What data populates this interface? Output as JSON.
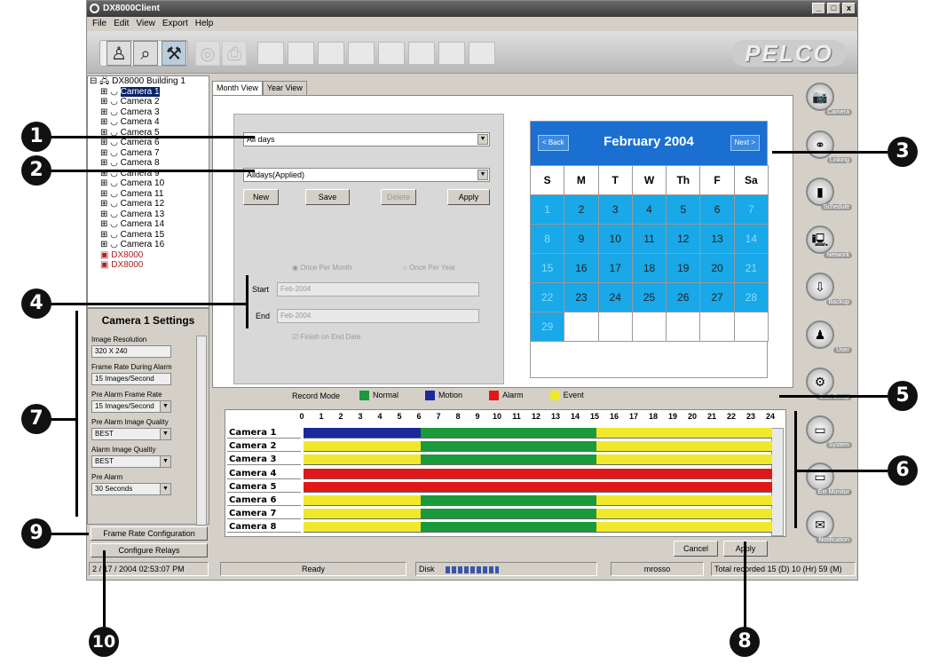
{
  "window": {
    "title": "DX8000Client",
    "controls": [
      "_",
      "□",
      "x"
    ]
  },
  "menu": [
    "File",
    "Edit",
    "View",
    "Export",
    "Help"
  ],
  "brand": "PELCO",
  "tree": {
    "root": "DX8000 Building 1",
    "items": [
      "Camera 1",
      "Camera 2",
      "Camera 3",
      "Camera 4",
      "Camera 5",
      "Camera 6",
      "Camera 7",
      "Camera 8",
      "Camera 9",
      "Camera 10",
      "Camera 11",
      "Camera 12",
      "Camera 13",
      "Camera 14",
      "Camera 15",
      "Camera 16"
    ],
    "second_root": "DX8000",
    "third_root": "DX8000"
  },
  "settings": {
    "title": "Camera 1 Settings",
    "fields": [
      {
        "label": "Image Resolution",
        "value": "320 X 240"
      },
      {
        "label": "Frame Rate During Alarm",
        "value": "15 Images/Second"
      },
      {
        "label": "Pre Alarm Frame Rate",
        "value": "15 Images/Second"
      },
      {
        "label": "Pre Alarm Image Quality",
        "value": "BEST"
      },
      {
        "label": "Alarm Image Quality",
        "value": "BEST"
      },
      {
        "label": "Pre Alarm",
        "value": "30 Seconds"
      }
    ],
    "frame_rate_btn": "Frame Rate Configuration",
    "relays_btn": "Configure Relays"
  },
  "tabs": [
    "Month View",
    "Year View"
  ],
  "schedule": {
    "days_value": "All days",
    "schedule_value": "Alldays(Applied)",
    "new": "New",
    "save": "Save",
    "delete": "Delete",
    "apply": "Apply",
    "radio1": "Once Per Month",
    "radio2": "Once Per Year",
    "start_label": "Start",
    "start_value": "Feb-2004",
    "end_label": "End",
    "end_value": "Feb-2004",
    "finish_label": "Finish on End Date"
  },
  "calendar": {
    "back": "< Back",
    "next": "Next >",
    "title": "February  2004",
    "dow": [
      "S",
      "M",
      "T",
      "W",
      "Th",
      "F",
      "Sa"
    ],
    "days": [
      "1",
      "2",
      "3",
      "4",
      "5",
      "6",
      "7",
      "8",
      "9",
      "10",
      "11",
      "12",
      "13",
      "14",
      "15",
      "16",
      "17",
      "18",
      "19",
      "20",
      "21",
      "22",
      "23",
      "24",
      "25",
      "26",
      "27",
      "28",
      "29"
    ]
  },
  "legend": {
    "title": "Record Mode",
    "items": [
      {
        "label": "Normal",
        "color": "#1a9a3a"
      },
      {
        "label": "Motion",
        "color": "#1a2a9a"
      },
      {
        "label": "Alarm",
        "color": "#e01818"
      },
      {
        "label": "Event",
        "color": "#f0e82a"
      }
    ]
  },
  "timeline": {
    "hours": [
      "0",
      "1",
      "2",
      "3",
      "4",
      "5",
      "6",
      "7",
      "8",
      "9",
      "10",
      "11",
      "12",
      "13",
      "14",
      "15",
      "16",
      "17",
      "18",
      "19",
      "20",
      "21",
      "22",
      "23",
      "24"
    ],
    "rows": [
      {
        "name": "Camera 1",
        "segments": [
          [
            "#1a2a9a",
            0,
            6
          ],
          [
            "#1a9a3a",
            6,
            15
          ],
          [
            "#f0e82a",
            15,
            24
          ]
        ]
      },
      {
        "name": "Camera 2",
        "segments": [
          [
            "#f0e82a",
            0,
            6
          ],
          [
            "#1a9a3a",
            6,
            15
          ],
          [
            "#f0e82a",
            15,
            24
          ]
        ]
      },
      {
        "name": "Camera 3",
        "segments": [
          [
            "#f0e82a",
            0,
            6
          ],
          [
            "#1a9a3a",
            6,
            15
          ],
          [
            "#f0e82a",
            15,
            24
          ]
        ]
      },
      {
        "name": "Camera 4",
        "segments": [
          [
            "#e01818",
            0,
            24
          ]
        ]
      },
      {
        "name": "Camera 5",
        "segments": [
          [
            "#e01818",
            0,
            24
          ]
        ]
      },
      {
        "name": "Camera 6",
        "segments": [
          [
            "#f0e82a",
            0,
            6
          ],
          [
            "#1a9a3a",
            6,
            15
          ],
          [
            "#f0e82a",
            15,
            24
          ]
        ]
      },
      {
        "name": "Camera 7",
        "segments": [
          [
            "#f0e82a",
            0,
            6
          ],
          [
            "#1a9a3a",
            6,
            15
          ],
          [
            "#f0e82a",
            15,
            24
          ]
        ]
      },
      {
        "name": "Camera 8",
        "segments": [
          [
            "#f0e82a",
            0,
            6
          ],
          [
            "#1a9a3a",
            6,
            15
          ],
          [
            "#f0e82a",
            15,
            24
          ]
        ]
      }
    ]
  },
  "footer": {
    "cancel": "Cancel",
    "apply": "Apply"
  },
  "statusbar": {
    "datetime": "2 / 17 / 2004  02:53:07 PM",
    "ready": "Ready",
    "disk": "Disk",
    "user": "mrosso",
    "recorded": "Total recorded 15 (D) 10 (Hr) 59 (M)"
  },
  "rightbar": [
    "Camera",
    "Linking",
    "Schedule",
    "Network",
    "Backup",
    "User",
    "Disk Setup",
    "System",
    "Ext Monitor",
    "Notification"
  ],
  "callouts": [
    "1",
    "2",
    "3",
    "4",
    "5",
    "6",
    "7",
    "8",
    "9",
    "10"
  ]
}
